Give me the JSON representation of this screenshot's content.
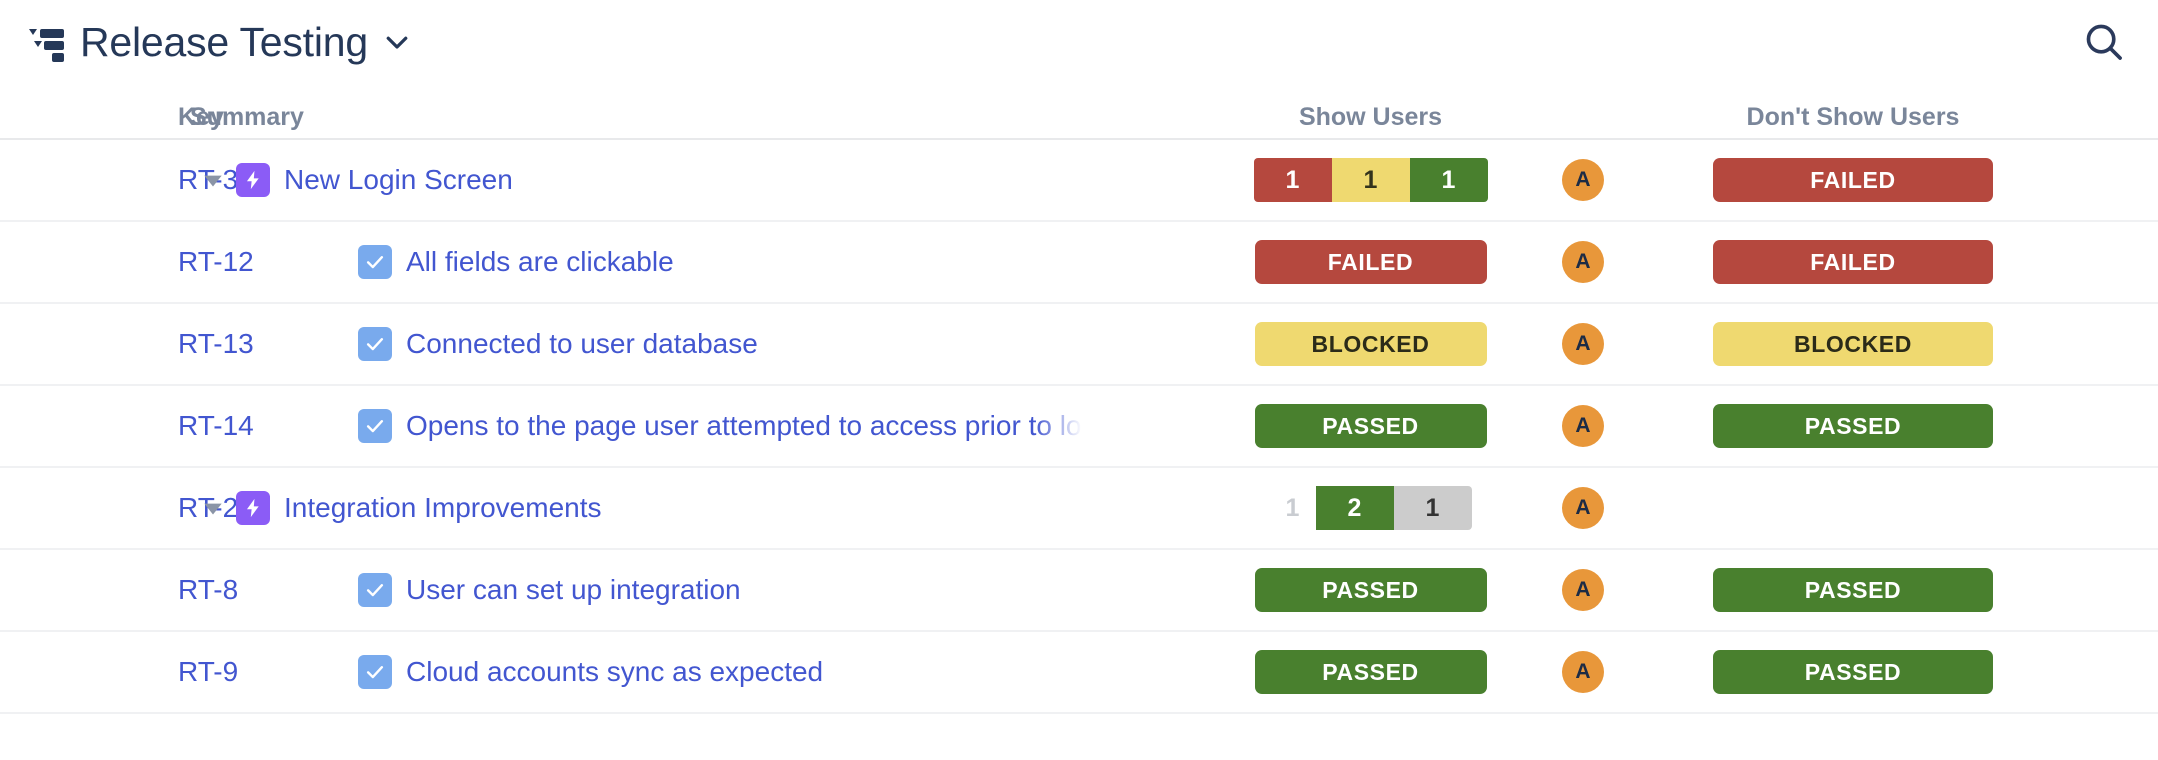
{
  "header": {
    "plan_icon": "test-plan-icon",
    "title": "Release Testing",
    "chevron": "chevron-down-icon",
    "search_icon": "search-icon"
  },
  "table": {
    "columns": {
      "key": "Key",
      "summary": "Summary",
      "show_users": "Show Users",
      "dont_show_users": "Don't Show Users"
    },
    "rows": [
      {
        "key": "RT-3",
        "kind": "epic",
        "toggle": "triangle-down-icon",
        "type_icon": "epic-lightning-icon",
        "summary": "New Login Screen",
        "show_users": {
          "mode": "segbar",
          "segments": [
            {
              "label": "1",
              "color": "red"
            },
            {
              "label": "1",
              "color": "yellow"
            },
            {
              "label": "1",
              "color": "green"
            }
          ]
        },
        "avatar": "A",
        "dont_show_users": {
          "mode": "badge",
          "status": "FAILED"
        }
      },
      {
        "key": "RT-12",
        "kind": "subtask",
        "type_icon": "subtask-check-icon",
        "summary": "All fields are clickable",
        "show_users": {
          "mode": "badge",
          "status": "FAILED"
        },
        "avatar": "A",
        "dont_show_users": {
          "mode": "badge",
          "status": "FAILED"
        }
      },
      {
        "key": "RT-13",
        "kind": "subtask",
        "type_icon": "subtask-check-icon",
        "summary": "Connected to user database",
        "show_users": {
          "mode": "badge",
          "status": "BLOCKED"
        },
        "avatar": "A",
        "dont_show_users": {
          "mode": "badge",
          "status": "BLOCKED"
        }
      },
      {
        "key": "RT-14",
        "kind": "subtask",
        "type_icon": "subtask-check-icon",
        "summary": "Opens to the page user attempted to access prior to lo",
        "clipped": true,
        "show_users": {
          "mode": "badge",
          "status": "PASSED"
        },
        "avatar": "A",
        "dont_show_users": {
          "mode": "badge",
          "status": "PASSED"
        }
      },
      {
        "key": "RT-2",
        "kind": "epic",
        "toggle": "triangle-down-icon",
        "type_icon": "epic-lightning-icon",
        "summary": "Integration Improvements",
        "show_users": {
          "mode": "segbar",
          "segments": [
            {
              "label": "1",
              "color": "ghost"
            },
            {
              "label": "2",
              "color": "green"
            },
            {
              "label": "1",
              "color": "grey"
            }
          ]
        },
        "avatar": "A",
        "dont_show_users": {
          "mode": "empty"
        }
      },
      {
        "key": "RT-8",
        "kind": "subtask",
        "type_icon": "subtask-check-icon",
        "summary": "User can set up integration",
        "show_users": {
          "mode": "badge",
          "status": "PASSED"
        },
        "avatar": "A",
        "dont_show_users": {
          "mode": "badge",
          "status": "PASSED"
        }
      },
      {
        "key": "RT-9",
        "kind": "subtask",
        "type_icon": "subtask-check-icon",
        "summary": "Cloud accounts sync as expected",
        "show_users": {
          "mode": "badge",
          "status": "PASSED"
        },
        "avatar": "A",
        "dont_show_users": {
          "mode": "badge",
          "status": "PASSED"
        }
      }
    ]
  },
  "colors": {
    "passed": "#49802e",
    "failed": "#b5483e",
    "blocked": "#efd970",
    "epic": "#8b5cf6",
    "subtask": "#79aaed",
    "link": "#4256d0",
    "avatar": "#e8973a",
    "heading": "#7a869a",
    "title": "#253858"
  }
}
